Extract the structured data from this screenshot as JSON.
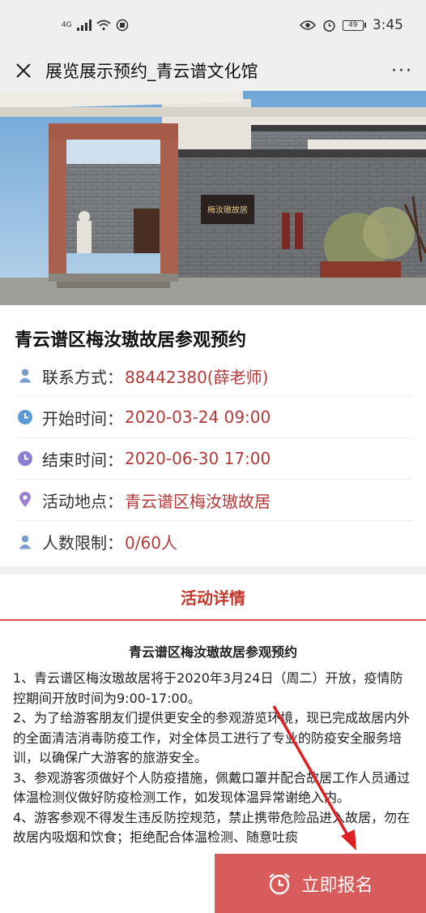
{
  "status_bar": {
    "network": "4G",
    "battery": "49",
    "time": "3:45"
  },
  "nav": {
    "title": "展览展示预约_青云谱文化馆",
    "more": "···"
  },
  "hero": {
    "sign_text": "梅汝璈故居"
  },
  "event": {
    "title": "青云谱区梅汝璈故居参观预约",
    "rows": [
      {
        "label": "联系方式：",
        "value": "88442380(薛老师)",
        "icon": "person-icon",
        "icon_color": "#7a9ccf"
      },
      {
        "label": "开始时间：",
        "value": "2020-03-24 09:00",
        "icon": "clock-icon",
        "icon_color": "#5b9bd5"
      },
      {
        "label": "结束时间：",
        "value": "2020-06-30 17:00",
        "icon": "clock-icon",
        "icon_color": "#8c7fd1"
      },
      {
        "label": "活动地点：",
        "value": "青云谱区梅汝璈故居",
        "icon": "location-pin-icon",
        "icon_color": "#9b7fd1"
      },
      {
        "label": "人数限制：",
        "value": "0/60人",
        "icon": "person-icon",
        "icon_color": "#7a9ccf"
      }
    ]
  },
  "details": {
    "tab_label": "活动详情",
    "article_title": "青云谱区梅汝璈故居参观预约",
    "paragraphs": [
      "1、青云谱区梅汝璈故居将于2020年3月24日（周二）开放，疫情防控期间开放时间为9:00-17:00。",
      "2、为了给游客朋友们提供更安全的参观游览环境，现已完成故居内外的全面清洁消毒防疫工作，对全体员工进行了专业的防疫安全服务培训，以确保广大游客的旅游安全。",
      "3、参观游客须做好个人防疫措施，佩戴口罩并配合故居工作人员通过体温检测仪做好防疫检测工作，如发现体温异常谢绝入内。",
      "4、游客参观不得发生违反防控规范，禁止携带危险品进入故居，勿在故居内吸烟和饮食；拒绝配合体温检测、随意吐痰"
    ]
  },
  "signup": {
    "label": "立即报名"
  },
  "colors": {
    "accent": "#d95c5c",
    "value_text": "#b33a3a"
  }
}
